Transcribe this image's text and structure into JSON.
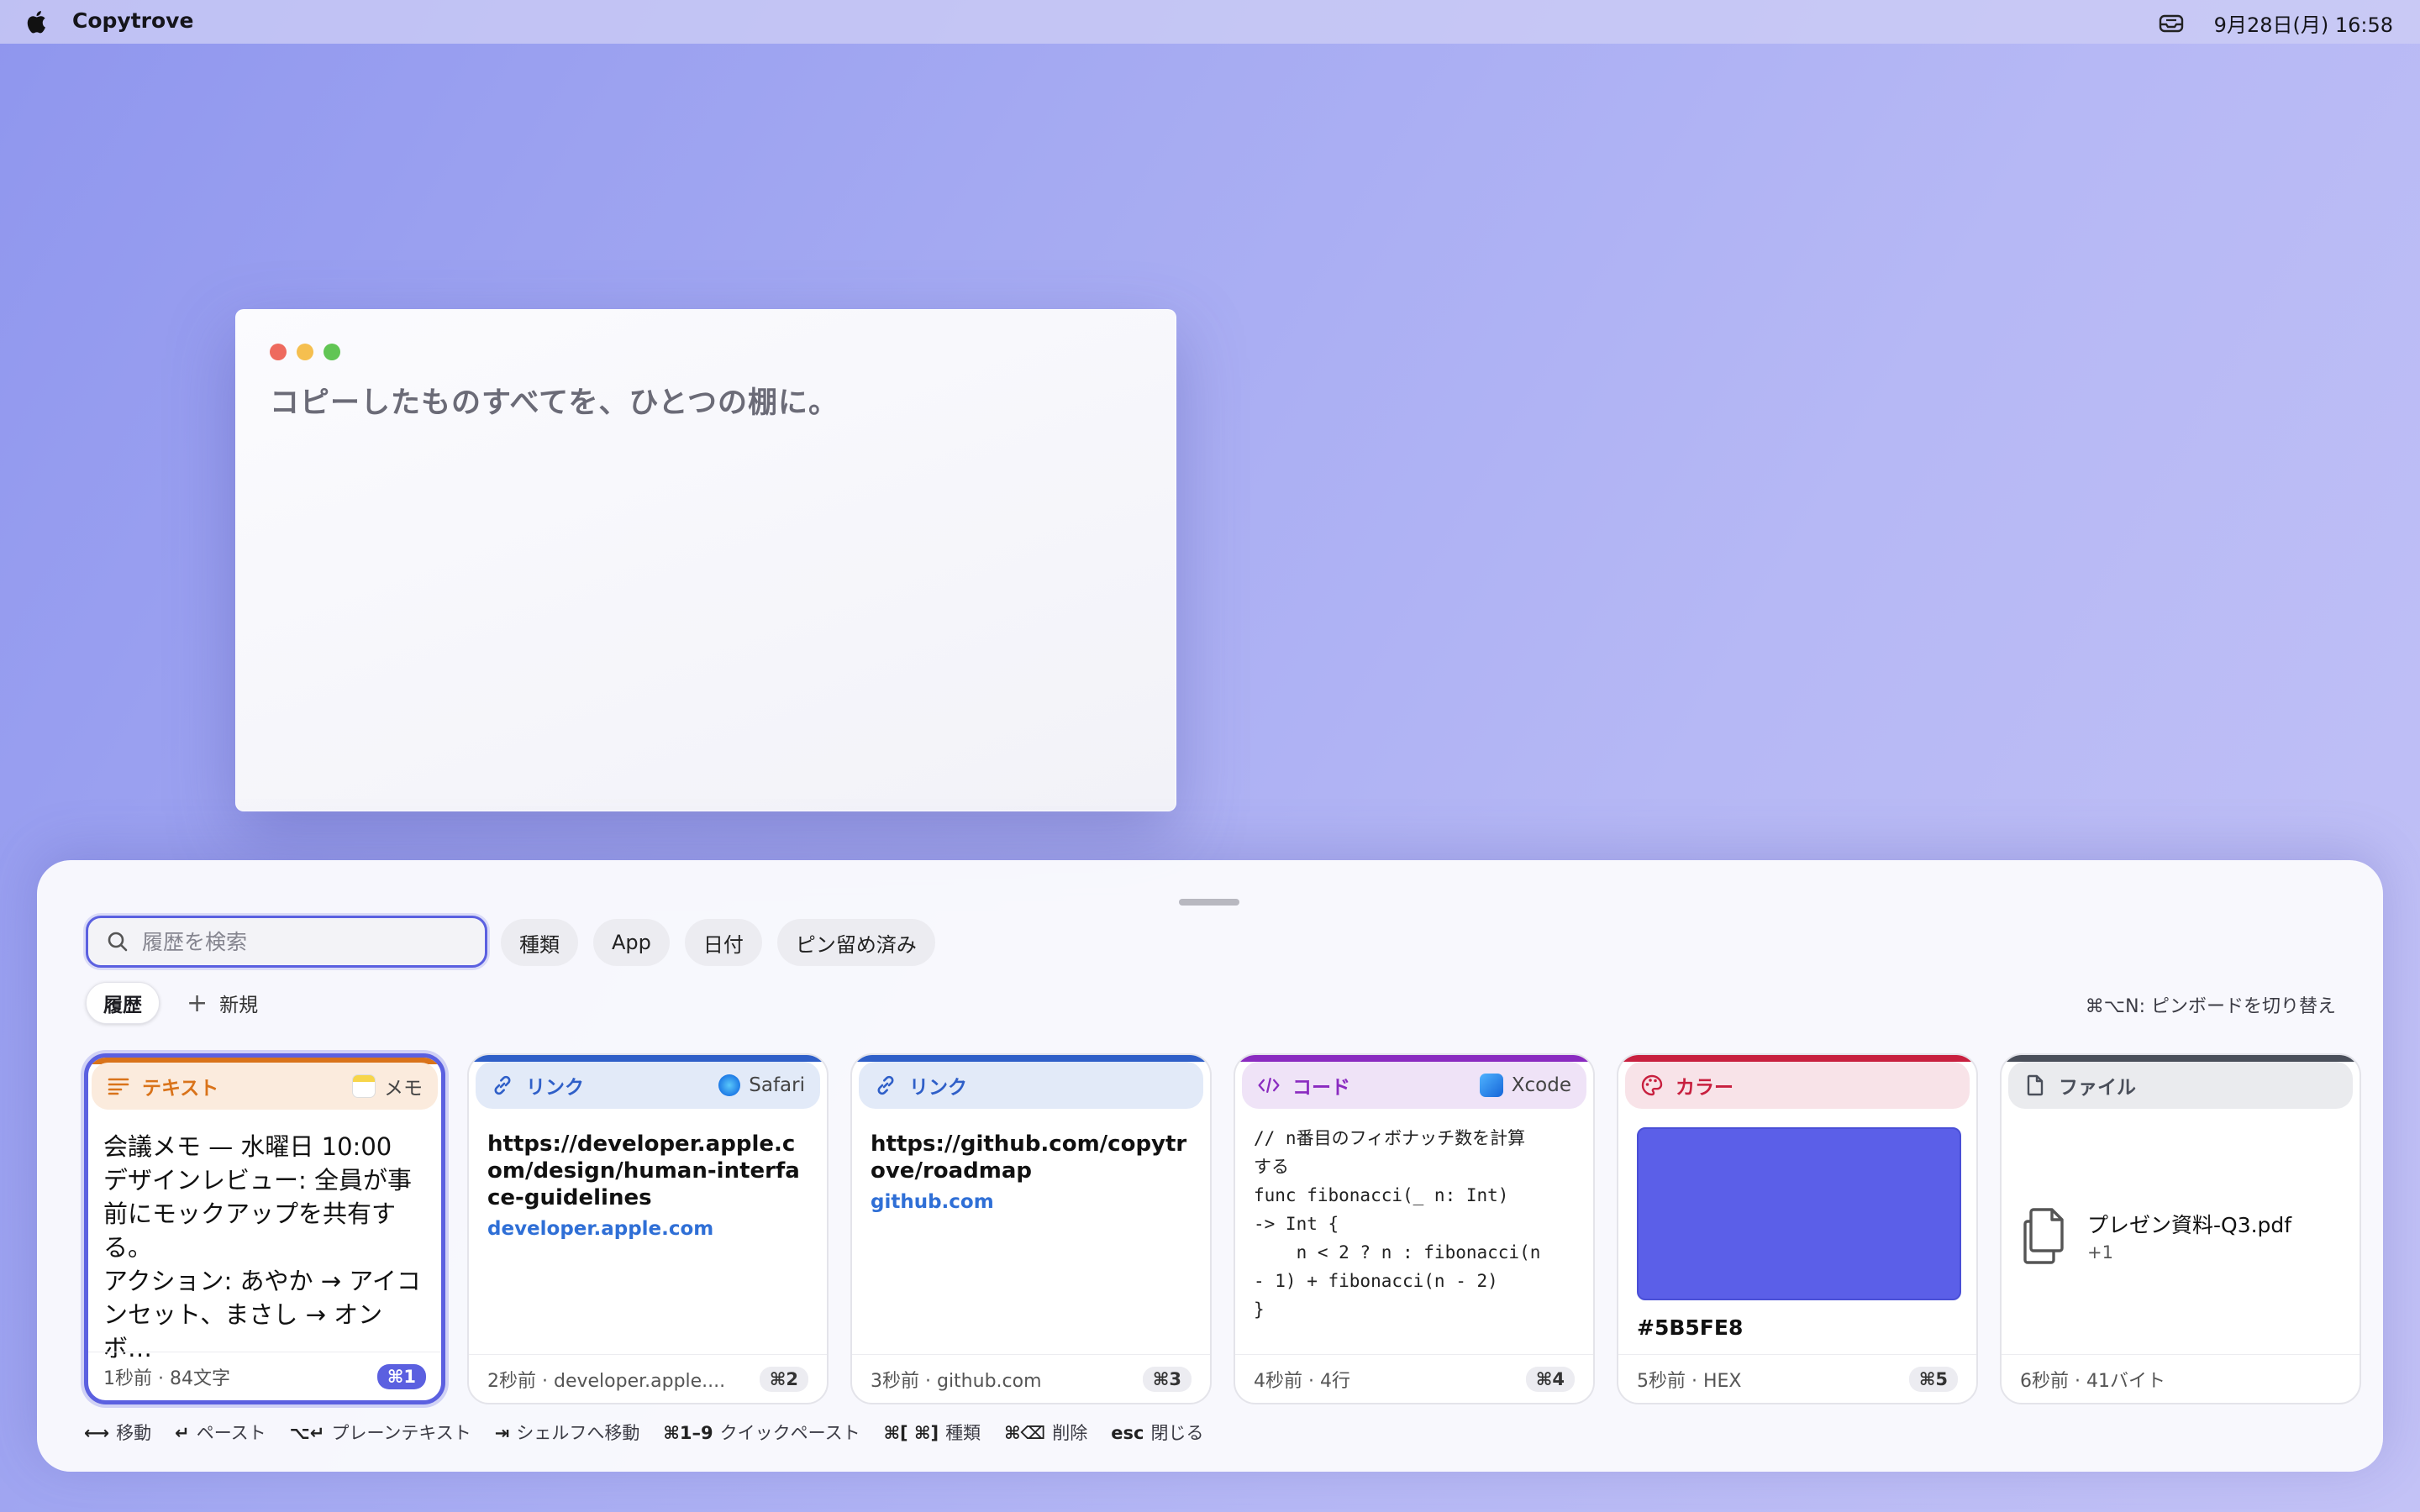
{
  "menubar": {
    "app_name": "Copytrove",
    "datetime": "9月28日(月) 16:58",
    "apple_icon": "apple-logo-icon",
    "status_icon": "inbox-tray-icon"
  },
  "window": {
    "tagline": "コピーしたものすべてを、ひとつの棚に。"
  },
  "shelf": {
    "search_placeholder": "履歴を検索",
    "filters": [
      "種類",
      "App",
      "日付",
      "ピン留め済み"
    ],
    "tabs": {
      "active": "履歴",
      "new_label": "新規"
    },
    "switch_hint": "⌘⌥N: ピンボードを切り替え",
    "accent_color": "#5B60E0",
    "cards": [
      {
        "type_label": "テキスト",
        "type_icon": "text-lines-icon",
        "accent": "#D9731A",
        "head_bg": "#FBEBDD",
        "source": "メモ",
        "source_icon": "notes-app-icon",
        "content": "会議メモ — 水曜日 10:00\nデザインレビュー: 全員が事前にモックアップを共有する。\nアクション: あやか → アイコンセット、まさし → オンボ…",
        "meta": "1秒前 · 84文字",
        "shortcut": "⌘1"
      },
      {
        "type_label": "リンク",
        "type_icon": "link-icon",
        "accent": "#2F5FC8",
        "head_bg": "#E2EAF8",
        "source": "Safari",
        "source_icon": "safari-icon",
        "url": "https://developer.apple.com/design/human-interface-guidelines",
        "host": "developer.apple.com",
        "meta": "2秒前 · developer.apple....",
        "shortcut": "⌘2"
      },
      {
        "type_label": "リンク",
        "type_icon": "link-icon",
        "accent": "#2F5FC8",
        "head_bg": "#E2EAF8",
        "source": "",
        "url": "https://github.com/copytrove/roadmap",
        "host": "github.com",
        "meta": "3秒前 · github.com",
        "shortcut": "⌘3"
      },
      {
        "type_label": "コード",
        "type_icon": "code-brackets-icon",
        "accent": "#8A2BC0",
        "head_bg": "#EFE3F7",
        "source": "Xcode",
        "source_icon": "xcode-icon",
        "code": "// n番目のフィボナッチ数を計算\nする\nfunc fibonacci(_ n: Int)\n-> Int {\n    n < 2 ? n : fibonacci(n\n- 1) + fibonacci(n - 2)\n}",
        "meta": "4秒前 · 4行",
        "shortcut": "⌘4"
      },
      {
        "type_label": "カラー",
        "type_icon": "palette-icon",
        "accent": "#C8203F",
        "head_bg": "#F8E3E8",
        "source": "",
        "color": "#5B5FE8",
        "hex_label": "#5B5FE8",
        "meta": "5秒前 · HEX",
        "shortcut": "⌘5"
      },
      {
        "type_label": "ファイル",
        "type_icon": "document-icon",
        "accent": "#4A4F5A",
        "head_bg": "#EAEBEE",
        "source": "",
        "file_name": "プレゼン資料-Q3.pdf",
        "file_more": "+1",
        "meta": "6秒前 · 41バイト",
        "shortcut": ""
      }
    ],
    "hints": [
      {
        "key": "⟷",
        "label": "移動"
      },
      {
        "key": "↵",
        "label": "ペースト"
      },
      {
        "key": "⌥↵",
        "label": "プレーンテキスト"
      },
      {
        "key": "⇥",
        "label": "シェルフへ移動"
      },
      {
        "key": "⌘1–9",
        "label": "クイックペースト"
      },
      {
        "key": "⌘[ ⌘]",
        "label": "種類"
      },
      {
        "key": "⌘⌫",
        "label": "削除"
      },
      {
        "key": "esc",
        "label": "閉じる"
      }
    ]
  }
}
